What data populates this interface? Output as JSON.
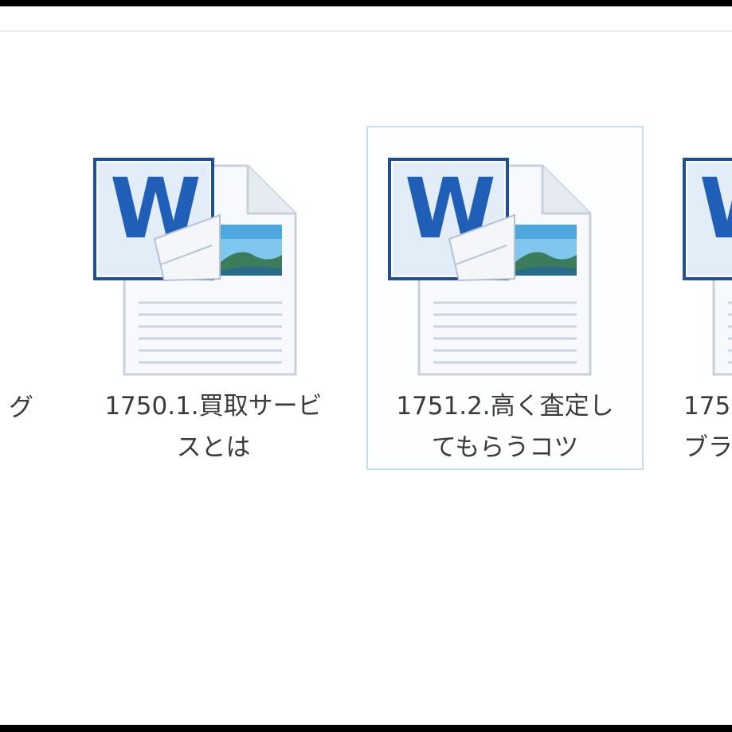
{
  "files": [
    {
      "name_line1": "グ",
      "name_line2": "",
      "icon": "word-document-icon",
      "selected": false
    },
    {
      "name_line1": "1750.1.買取サービ",
      "name_line2": "スとは",
      "icon": "word-document-icon",
      "selected": false
    },
    {
      "name_line1": "1751.2.高く査定し",
      "name_line2": "てもらうコツ",
      "icon": "word-document-icon",
      "selected": true
    },
    {
      "name_line1": "175",
      "name_line2": "ブラ",
      "icon": "word-document-icon",
      "selected": false
    }
  ],
  "colors": {
    "word_blue": "#1f5fb8",
    "selection_border": "#c5dff4",
    "text": "#3a3a3a"
  }
}
